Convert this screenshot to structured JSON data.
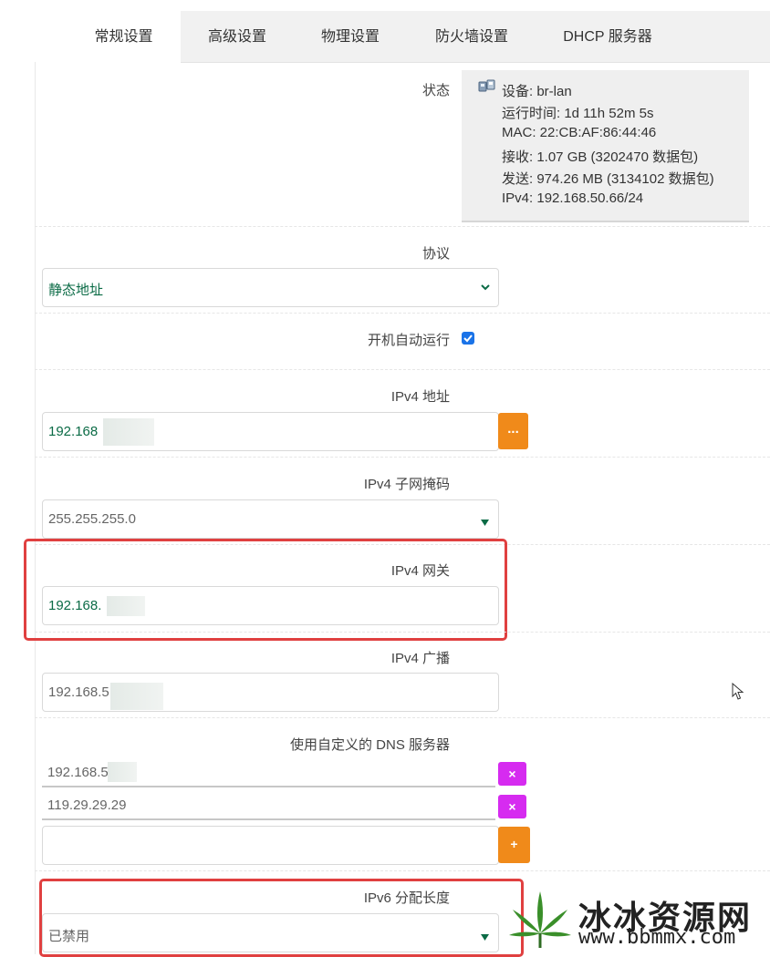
{
  "tabs": [
    {
      "label": "常规设置",
      "active": true
    },
    {
      "label": "高级设置",
      "active": false
    },
    {
      "label": "物理设置",
      "active": false
    },
    {
      "label": "防火墙设置",
      "active": false
    },
    {
      "label": "DHCP 服务器",
      "active": false
    }
  ],
  "status": {
    "label": "状态",
    "device": "设备: br-lan",
    "uptime": "运行时间: 1d 11h 52m 5s",
    "mac": "MAC: 22:CB:AF:86:44:46",
    "rx": "接收: 1.07 GB (3202470 数据包)",
    "tx": "发送: 974.26 MB (3134102 数据包)",
    "ipv4": "IPv4: 192.168.50.66/24"
  },
  "protocol": {
    "label": "协议",
    "value": "静态地址"
  },
  "autostart": {
    "label": "开机自动运行",
    "checked": true
  },
  "ipv4_address": {
    "label": "IPv4 地址",
    "value": "192.168",
    "button": "..."
  },
  "ipv4_netmask": {
    "label": "IPv4 子网掩码",
    "value": "255.255.255.0"
  },
  "ipv4_gateway": {
    "label": "IPv4 网关",
    "value": "192.168."
  },
  "ipv4_broadcast": {
    "label": "IPv4 广播",
    "value": "192.168.5"
  },
  "dns": {
    "label": "使用自定义的 DNS 服务器",
    "entries": [
      "192.168.5",
      "119.29.29.29"
    ],
    "remove_label": "×",
    "add_label": "+"
  },
  "ipv6_assign": {
    "label": "IPv6 分配长度",
    "value": "已禁用"
  },
  "watermark": {
    "name": "冰冰资源网",
    "url": "www.bbmmx.com"
  },
  "colors": {
    "accent_green": "#0b6b46",
    "orange": "#f08a1a",
    "magenta": "#d62bf0",
    "highlight_red": "#e04040"
  }
}
